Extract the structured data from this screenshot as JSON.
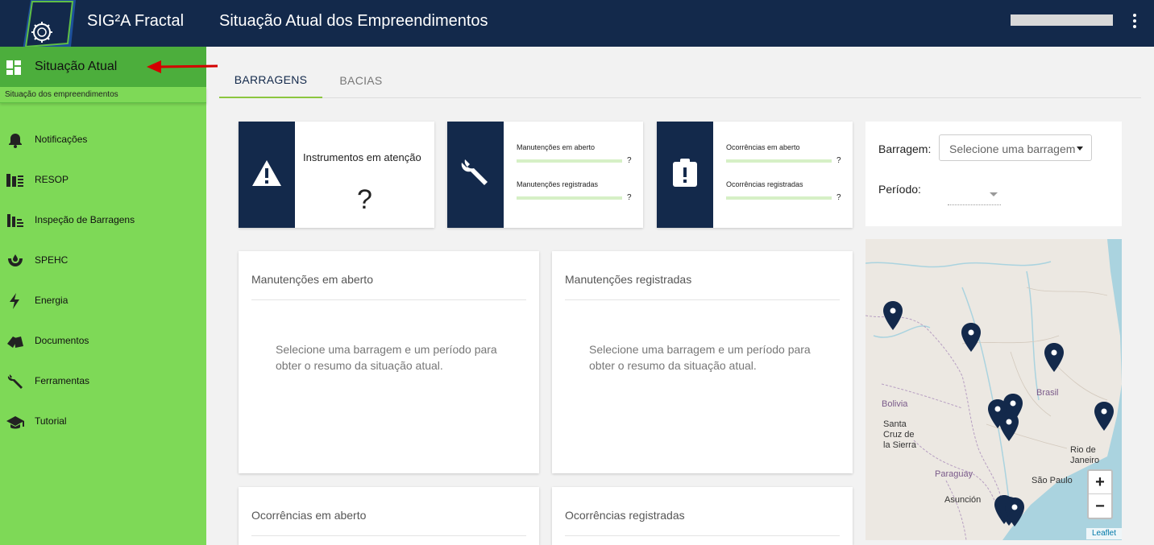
{
  "header": {
    "app_name": "SIG²A Fractal",
    "page_title": "Situação Atual dos Empreendimentos"
  },
  "sidebar": {
    "active": {
      "label": "Situação Atual",
      "subtitle": "Situação dos empreendimentos"
    },
    "items": [
      {
        "label": "Notificações",
        "icon": "bell-icon"
      },
      {
        "label": "RESOP",
        "icon": "resop-icon"
      },
      {
        "label": "Inspeção de Barragens",
        "icon": "inspection-icon"
      },
      {
        "label": "SPEHC",
        "icon": "spehc-icon"
      },
      {
        "label": "Energia",
        "icon": "lightning-icon"
      },
      {
        "label": "Documentos",
        "icon": "documents-icon"
      },
      {
        "label": "Ferramentas",
        "icon": "wrench-icon"
      },
      {
        "label": "Tutorial",
        "icon": "graduation-cap-icon"
      }
    ]
  },
  "tabs": [
    {
      "label": "BARRAGENS",
      "active": true
    },
    {
      "label": "BACIAS",
      "active": false
    }
  ],
  "info_cards": {
    "instrumentos": {
      "title": "Instrumentos em atenção",
      "value": "?"
    },
    "manutencoes": {
      "open_label": "Manutenções em aberto",
      "open_value": "?",
      "reg_label": "Manutenções registradas",
      "reg_value": "?"
    },
    "ocorrencias": {
      "open_label": "Ocorrências em aberto",
      "open_value": "?",
      "reg_label": "Ocorrências registradas",
      "reg_value": "?"
    }
  },
  "filters": {
    "barragem_label": "Barragem:",
    "barragem_placeholder": "Selecione uma barragem",
    "periodo_label": "Período:"
  },
  "panels": {
    "manut_aberto": "Manutenções em aberto",
    "manut_registradas": "Manutenções registradas",
    "ocorr_aberto": "Ocorrências em aberto",
    "ocorr_registradas": "Ocorrências registradas",
    "empty_msg": "Selecione uma barragem e um período para obter o resumo da situação atual."
  },
  "map": {
    "labels": {
      "brasil": "Brasil",
      "bolivia": "Bolivia",
      "santa_cruz": "Santa Cruz de la Sierra",
      "paraguay": "Paraguay",
      "asuncion": "Asunción",
      "rio": "Rio de Janeiro",
      "sao_paulo": "São Paulo"
    },
    "zoom_in": "+",
    "zoom_out": "−",
    "attribution": "Leaflet"
  },
  "colors": {
    "navy": "#13294b",
    "sidebar_green": "#7ed957",
    "active_green": "#4cae3c",
    "accent_green": "#8cc63f",
    "arrow_red": "#d40000"
  }
}
